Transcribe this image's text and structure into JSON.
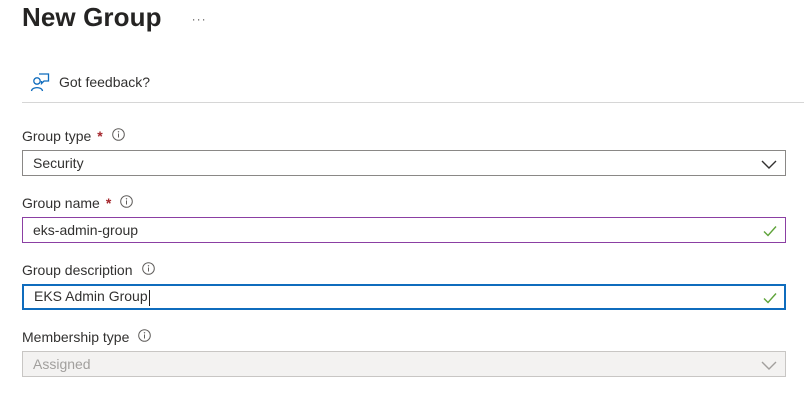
{
  "header": {
    "title": "New Group",
    "more_label": "···"
  },
  "toolbar": {
    "feedback_label": "Got feedback?"
  },
  "form": {
    "group_type": {
      "label": "Group type",
      "required_mark": "*",
      "value": "Security"
    },
    "group_name": {
      "label": "Group name",
      "required_mark": "*",
      "value": "eks-admin-group"
    },
    "group_description": {
      "label": "Group description",
      "value": "EKS Admin Group"
    },
    "membership_type": {
      "label": "Membership type",
      "value": "Assigned"
    }
  },
  "colors": {
    "required": "#a4262c",
    "focus_border": "#0f6cbd",
    "hover_border": "#8b3fa3",
    "valid_check": "#5ea339",
    "feedback_icon": "#0f6cbd"
  },
  "icons": {
    "feedback": "person-feedback-icon",
    "info": "info-circle-icon",
    "dropdown": "chevron-down-icon",
    "valid": "checkmark-icon"
  }
}
